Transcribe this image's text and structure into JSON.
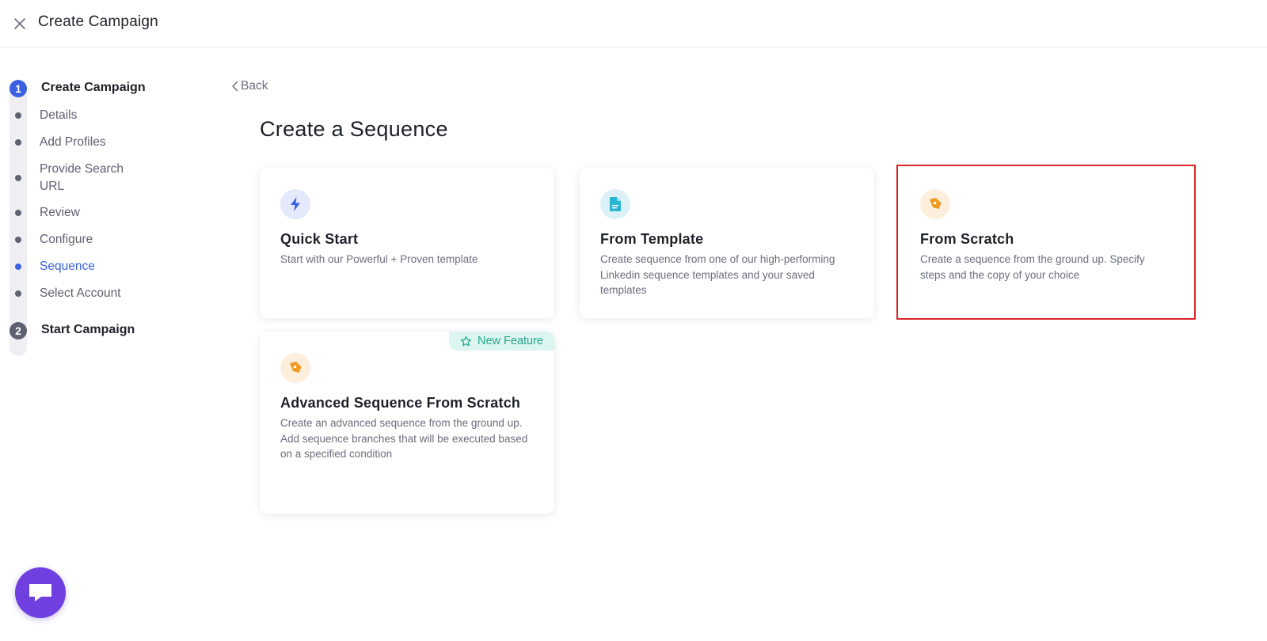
{
  "header": {
    "title": "Create Campaign",
    "close_icon": "close-icon"
  },
  "stepper": {
    "steps": [
      {
        "number": "1",
        "label": "Create Campaign",
        "active": true,
        "substeps": [
          {
            "label": "Details",
            "active": false
          },
          {
            "label": "Add Profiles",
            "active": false
          },
          {
            "label": "Provide Search URL",
            "active": false
          },
          {
            "label": "Review",
            "active": false
          },
          {
            "label": "Configure",
            "active": false
          },
          {
            "label": "Sequence",
            "active": true
          },
          {
            "label": "Select Account",
            "active": false
          }
        ]
      },
      {
        "number": "2",
        "label": "Start Campaign",
        "active": false
      }
    ]
  },
  "main": {
    "back_label": "Back",
    "title": "Create a Sequence",
    "cards": [
      {
        "id": "quick-start",
        "title": "Quick Start",
        "description": "Start with our Powerful + Proven template",
        "icon": "lightning-icon"
      },
      {
        "id": "from-template",
        "title": "From Template",
        "description": "Create sequence from one of our high-performing Linkedin sequence templates and your saved templates",
        "icon": "document-icon"
      },
      {
        "id": "from-scratch",
        "title": "From Scratch",
        "description": "Create a sequence from the ground up. Specify steps and the copy of your choice",
        "icon": "pen-tool-icon",
        "highlighted": true
      },
      {
        "id": "advanced-from-scratch",
        "title": "Advanced Sequence From Scratch",
        "description_lines": [
          "Create an advanced sequence from the ground up.",
          "Add sequence branches that will be executed based on a specified condition"
        ],
        "badge": "New Feature",
        "icon": "pen-tool-icon"
      }
    ]
  },
  "colors": {
    "accent": "#3a62e0",
    "highlight": "#d9262a",
    "badge_bg": "#dcf5f0",
    "badge_text": "#22a58a",
    "chat_fab": "#6f3fe0"
  },
  "chat": {
    "icon": "chat-bubble-icon"
  }
}
